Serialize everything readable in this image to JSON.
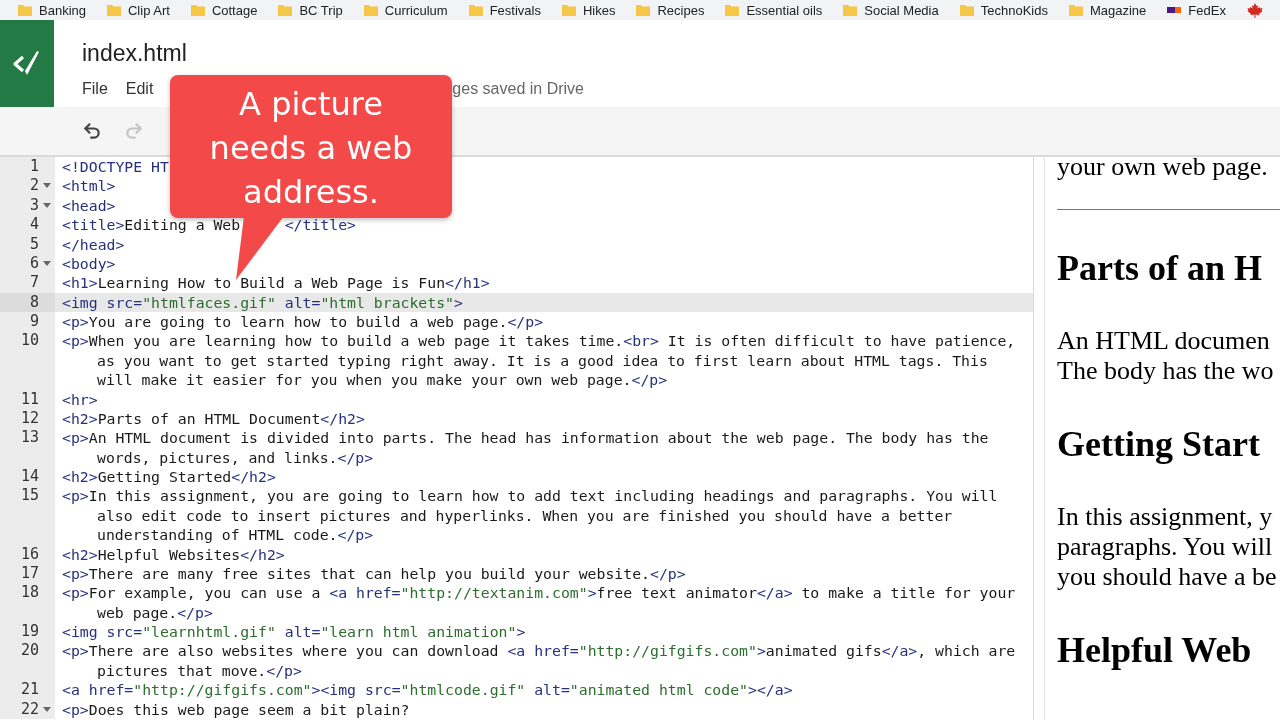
{
  "bookmarks": [
    {
      "kind": "folder",
      "label": "Banking"
    },
    {
      "kind": "folder",
      "label": "Clip Art"
    },
    {
      "kind": "folder",
      "label": "Cottage"
    },
    {
      "kind": "folder",
      "label": "BC Trip"
    },
    {
      "kind": "folder",
      "label": "Curriculum"
    },
    {
      "kind": "folder",
      "label": "Festivals"
    },
    {
      "kind": "folder",
      "label": "Hikes"
    },
    {
      "kind": "folder",
      "label": "Recipes"
    },
    {
      "kind": "folder",
      "label": "Essential oils"
    },
    {
      "kind": "folder",
      "label": "Social Media"
    },
    {
      "kind": "folder",
      "label": "TechnoKids"
    },
    {
      "kind": "folder",
      "label": "Magazine"
    },
    {
      "kind": "fedex",
      "label": "FedEx"
    },
    {
      "kind": "maple-leaf"
    }
  ],
  "app": {
    "file_name": "index.html",
    "menu": [
      "File",
      "Edit"
    ],
    "save_status": "ges saved in Drive"
  },
  "toolbar": [
    {
      "kind": "undo",
      "disabled": false
    },
    {
      "kind": "redo",
      "disabled": true
    }
  ],
  "callout": {
    "text": "A picture needs a web address."
  },
  "editor": {
    "lines": [
      {
        "number": "1",
        "foldable": false,
        "selected": false,
        "rows": [
          [
            "<!DOCTYPE HT"
          ]
        ]
      },
      {
        "number": "2",
        "foldable": true,
        "selected": false,
        "rows": [
          [
            "<html>"
          ]
        ]
      },
      {
        "number": "3",
        "foldable": true,
        "selected": false,
        "rows": [
          [
            "<head>"
          ]
        ]
      },
      {
        "number": "4",
        "foldable": false,
        "selected": false,
        "rows": [
          [
            "<title>Editing a Web",
            "</title>"
          ]
        ]
      },
      {
        "number": "5",
        "foldable": false,
        "selected": false,
        "rows": [
          [
            "</head>"
          ]
        ]
      },
      {
        "number": "6",
        "foldable": true,
        "selected": false,
        "rows": [
          [
            "<body>"
          ]
        ]
      },
      {
        "number": "7",
        "foldable": false,
        "selected": false,
        "rows": [
          [
            "<h1>Learning How to Build a Web Page is Fun</h1>"
          ]
        ]
      },
      {
        "number": "8",
        "foldable": false,
        "selected": true,
        "rows": [
          [
            "<img src=\"htmlfaces.gif\" alt=\"html brackets\">"
          ]
        ]
      },
      {
        "number": "9",
        "foldable": false,
        "selected": false,
        "rows": [
          [
            "<p>You are going to learn how to build a web page.</p>"
          ]
        ]
      },
      {
        "number": "10",
        "foldable": false,
        "selected": false,
        "rows": [
          [
            "<p>When you are learning how to build a web page it takes time.<br> It is often difficult to have patience,"
          ],
          [
            "as you want to get started typing right away. It is a good idea to first learn about HTML tags. This"
          ],
          [
            "will make it easier for you when you make your own web page.</p>"
          ]
        ]
      },
      {
        "number": "11",
        "foldable": false,
        "selected": false,
        "rows": [
          [
            "<hr>"
          ]
        ]
      },
      {
        "number": "12",
        "foldable": false,
        "selected": false,
        "rows": [
          [
            "<h2>Parts of an HTML Document</h2>"
          ]
        ]
      },
      {
        "number": "13",
        "foldable": false,
        "selected": false,
        "rows": [
          [
            "<p>An HTML document is divided into parts. The head has information about the web page. The body has the"
          ],
          [
            "words, pictures, and links.</p>"
          ]
        ]
      },
      {
        "number": "14",
        "foldable": false,
        "selected": false,
        "rows": [
          [
            "<h2>Getting Started</h2>"
          ]
        ]
      },
      {
        "number": "15",
        "foldable": false,
        "selected": false,
        "rows": [
          [
            "<p>In this assignment, you are going to learn how to add text including headings and paragraphs. You will"
          ],
          [
            "also edit code to insert pictures and hyperlinks. When you are finished you should have a better"
          ],
          [
            "understanding of HTML code.</p>"
          ]
        ]
      },
      {
        "number": "16",
        "foldable": false,
        "selected": false,
        "rows": [
          [
            "<h2>Helpful Websites</h2>"
          ]
        ]
      },
      {
        "number": "17",
        "foldable": false,
        "selected": false,
        "rows": [
          [
            "<p>There are many free sites that can help you build your website.</p>"
          ]
        ]
      },
      {
        "number": "18",
        "foldable": false,
        "selected": false,
        "rows": [
          [
            "<p>For example, you can use a <a href=\"http://textanim.com\">free text animator</a> to make a title for your"
          ],
          [
            "web page.</p>"
          ]
        ]
      },
      {
        "number": "19",
        "foldable": false,
        "selected": false,
        "rows": [
          [
            "<img src=\"learnhtml.gif\" alt=\"learn html animation\">"
          ]
        ]
      },
      {
        "number": "20",
        "foldable": false,
        "selected": false,
        "rows": [
          [
            "<p>There are also websites where you can download <a href=\"http://gifgifs.com\">animated gifs</a>, which are"
          ],
          [
            "pictures that move.</p>"
          ]
        ]
      },
      {
        "number": "21",
        "foldable": false,
        "selected": false,
        "rows": [
          [
            "<a href=\"http://gifgifs.com\"><img src=\"htmlcode.gif\" alt=\"animated html code\"></a>"
          ]
        ]
      },
      {
        "number": "22",
        "foldable": true,
        "selected": false,
        "rows": [
          [
            "<p>Does this web page seem a bit plain?"
          ]
        ]
      }
    ]
  },
  "preview": {
    "blocks": [
      {
        "kind": "paragraph",
        "lines": [
          "your own web page."
        ]
      },
      {
        "kind": "rule"
      },
      {
        "kind": "heading",
        "text": "Parts of an H"
      },
      {
        "kind": "paragraph",
        "lines": [
          "An HTML documen",
          "The body has the wo"
        ]
      },
      {
        "kind": "heading",
        "text": "Getting Start"
      },
      {
        "kind": "paragraph",
        "lines": [
          "In this assignment, y",
          "paragraphs. You will",
          "you should have a be"
        ]
      },
      {
        "kind": "heading",
        "text": "Helpful Web"
      }
    ]
  }
}
